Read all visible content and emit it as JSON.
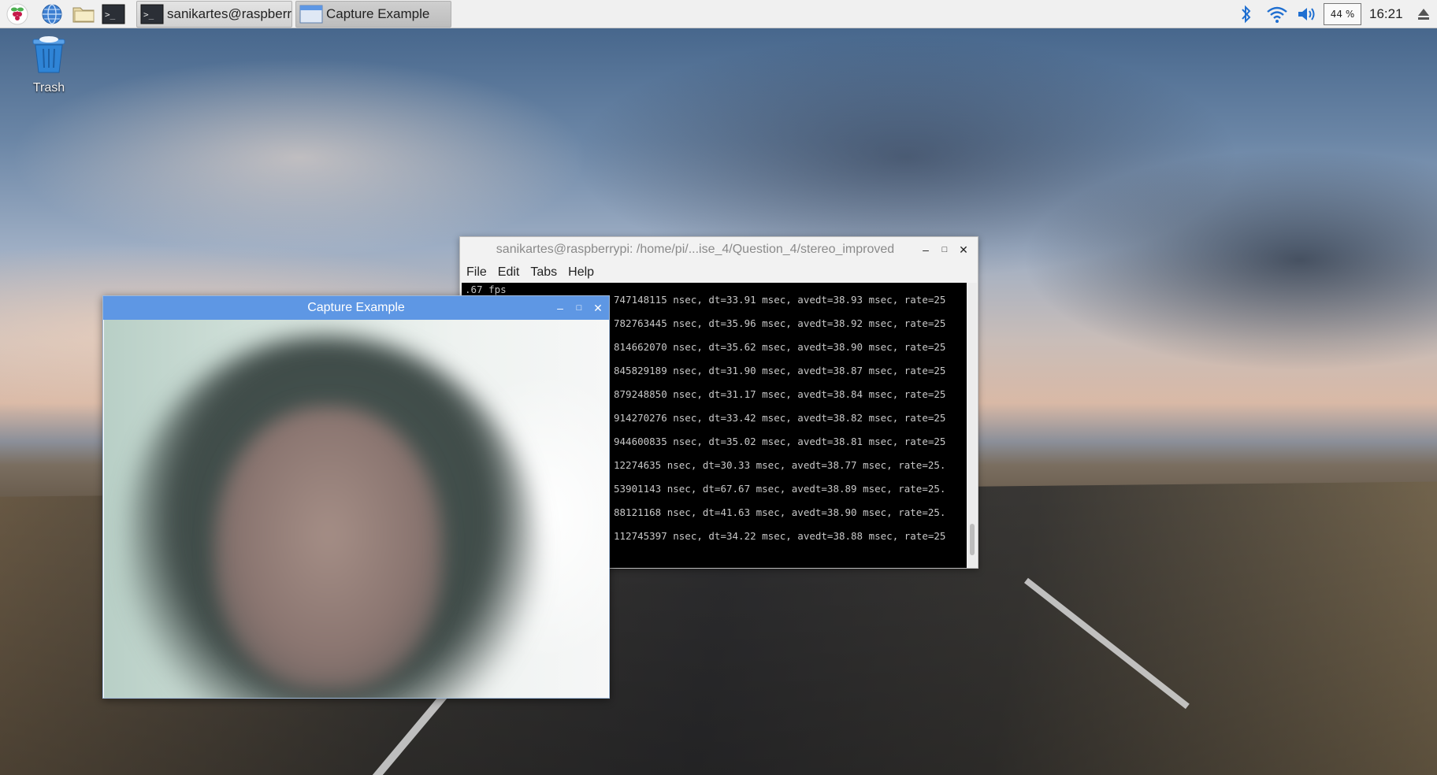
{
  "taskbar": {
    "launchers": [
      {
        "name": "raspberry-menu-icon"
      },
      {
        "name": "web-browser-icon"
      },
      {
        "name": "file-manager-icon"
      },
      {
        "name": "terminal-icon"
      }
    ],
    "tasks": [
      {
        "label": "sanikartes@raspberr...",
        "icon": "terminal-icon",
        "active": false
      },
      {
        "label": "Capture Example",
        "icon": "window-icon",
        "active": true
      }
    ],
    "tray": {
      "icons": [
        "bluetooth-icon",
        "wifi-icon",
        "volume-icon"
      ],
      "cpu_usage": "44 %",
      "clock": "16:21",
      "eject_icon": "eject-icon"
    }
  },
  "desktop": {
    "trash_label": "Trash"
  },
  "terminal": {
    "title": "sanikartes@raspberrypi: /home/pi/...ise_4/Question_4/stereo_improved",
    "menu": [
      "File",
      "Edit",
      "Tabs",
      "Help"
    ],
    "first_line": ".67 fps",
    "lines": [
      "747148115 nsec, dt=33.91 msec, avedt=38.93 msec, rate=25",
      "782763445 nsec, dt=35.96 msec, avedt=38.92 msec, rate=25",
      "814662070 nsec, dt=35.62 msec, avedt=38.90 msec, rate=25",
      "845829189 nsec, dt=31.90 msec, avedt=38.87 msec, rate=25",
      "879248850 nsec, dt=31.17 msec, avedt=38.84 msec, rate=25",
      "914270276 nsec, dt=33.42 msec, avedt=38.82 msec, rate=25",
      "944600835 nsec, dt=35.02 msec, avedt=38.81 msec, rate=25",
      "12274635 nsec, dt=30.33 msec, avedt=38.77 msec, rate=25.",
      "53901143 nsec, dt=67.67 msec, avedt=38.89 msec, rate=25.",
      "88121168 nsec, dt=41.63 msec, avedt=38.90 msec, rate=25.",
      "112745397 nsec, dt=34.22 msec, avedt=38.88 msec, rate=25"
    ]
  },
  "capture_window": {
    "title": "Capture Example"
  },
  "colors": {
    "panel_bg": "#f0f0f0",
    "capture_titlebar": "#5e97e4",
    "terminal_bg": "#000000",
    "terminal_text": "#c8c8c8"
  }
}
